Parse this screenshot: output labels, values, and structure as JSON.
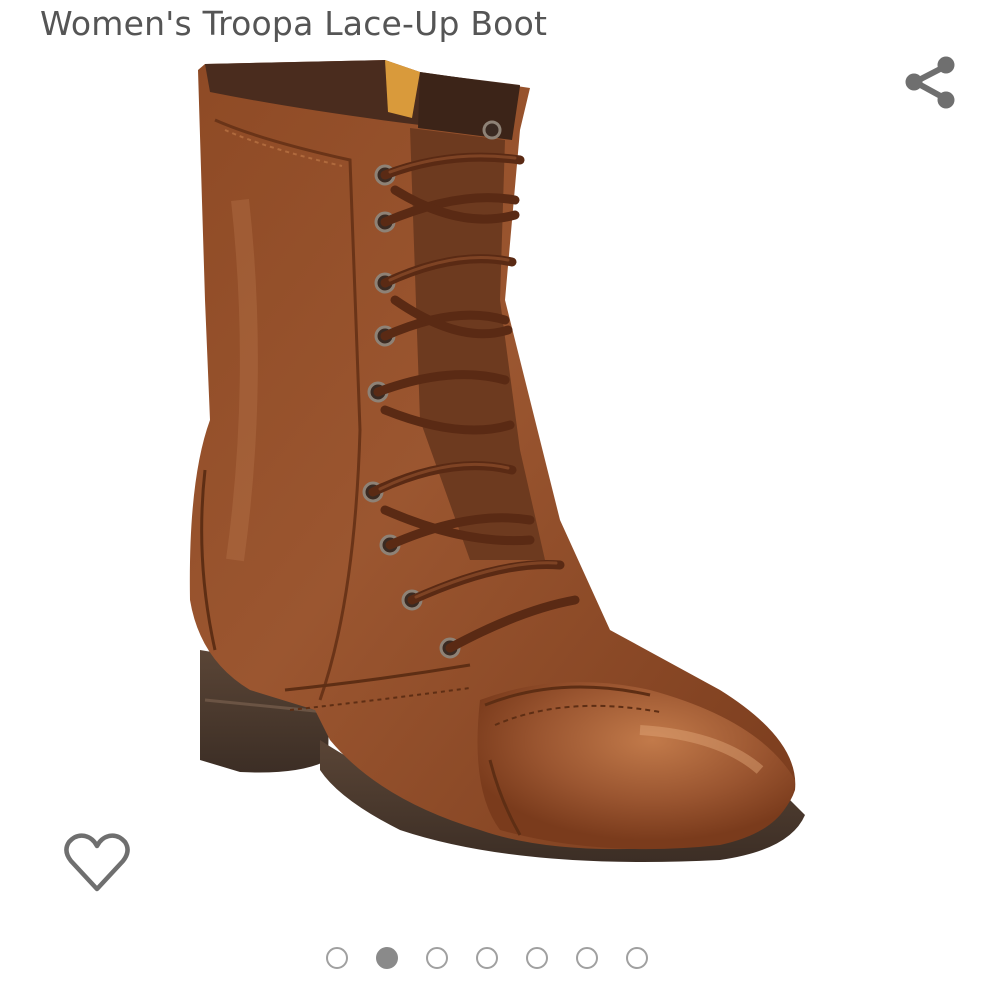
{
  "product": {
    "title": "Women's Troopa Lace-Up Boot"
  },
  "icons": {
    "share": "share-icon",
    "wishlist": "heart-outline-icon",
    "image": "brown-leather-lace-up-boot"
  },
  "carousel": {
    "total": 7,
    "active_index": 1
  },
  "colors": {
    "title": "#555555",
    "icon": "#6f6f6f",
    "dot_border": "#a0a0a0",
    "dot_active": "#8a8a8a"
  }
}
